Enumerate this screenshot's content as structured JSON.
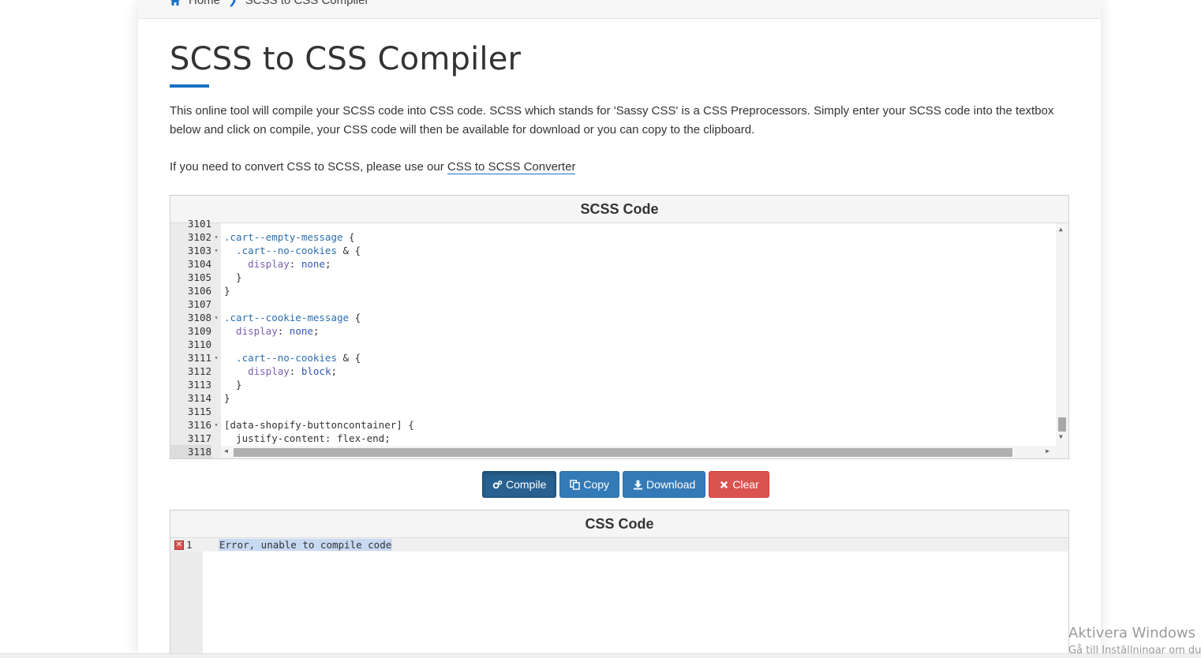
{
  "breadcrumb": {
    "home": "Home",
    "current": "SCSS to CSS Compiler"
  },
  "page": {
    "title": "SCSS to CSS Compiler",
    "intro": "This online tool will compile your SCSS code into CSS code. SCSS which stands for 'Sassy CSS' is a CSS Preprocessors. Simply enter your SCSS code into the textbox below and click on compile, your CSS code will then be available for download or you can copy to the clipboard.",
    "convert_prefix": "If you need to convert CSS to SCSS, please use our ",
    "convert_link": "CSS to SCSS Converter"
  },
  "scss_panel": {
    "title": "SCSS Code",
    "lines": [
      {
        "n": "3101",
        "fold": "",
        "sel": "",
        "rest": ""
      },
      {
        "n": "3102",
        "fold": "▾",
        "sel": ".cart--empty-message",
        "rest": " {"
      },
      {
        "n": "3103",
        "fold": "▾",
        "sel": "  .cart--no-cookies",
        "rest": " & {"
      },
      {
        "n": "3104",
        "fold": "",
        "prop": "    display",
        "val": "none",
        "rest": ";"
      },
      {
        "n": "3105",
        "fold": "",
        "sel": "",
        "rest": "  }"
      },
      {
        "n": "3106",
        "fold": "",
        "sel": "",
        "rest": "}"
      },
      {
        "n": "3107",
        "fold": "",
        "sel": "",
        "rest": ""
      },
      {
        "n": "3108",
        "fold": "▾",
        "sel": ".cart--cookie-message",
        "rest": " {"
      },
      {
        "n": "3109",
        "fold": "",
        "prop": "  display",
        "val": "none",
        "rest": ";"
      },
      {
        "n": "3110",
        "fold": "",
        "sel": "",
        "rest": ""
      },
      {
        "n": "3111",
        "fold": "▾",
        "sel": "  .cart--no-cookies",
        "rest": " & {"
      },
      {
        "n": "3112",
        "fold": "",
        "prop": "    display",
        "val": "block",
        "rest": ";"
      },
      {
        "n": "3113",
        "fold": "",
        "sel": "",
        "rest": "  }"
      },
      {
        "n": "3114",
        "fold": "",
        "sel": "",
        "rest": "}"
      },
      {
        "n": "3115",
        "fold": "",
        "sel": "",
        "rest": ""
      },
      {
        "n": "3116",
        "fold": "▾",
        "sel": "",
        "rest": "[data-shopify-buttoncontainer] {"
      },
      {
        "n": "3117",
        "fold": "",
        "sel": "",
        "rest": "  justify-content: flex-end;"
      },
      {
        "n": "3118",
        "fold": "",
        "sel": "",
        "rest": ""
      }
    ]
  },
  "buttons": {
    "compile": "Compile",
    "copy": "Copy",
    "download": "Download",
    "clear": "Clear"
  },
  "css_panel": {
    "title": "CSS Code",
    "line_number": "1",
    "error_text": "Error, unable to compile code"
  },
  "watermark": {
    "line1": "Aktivera Windows",
    "line2": "Gå till Inställningar om du"
  },
  "colors": {
    "primary": "#337ab7",
    "primary_active": "#286090",
    "danger": "#d9534f",
    "accent": "#1a6fc4"
  }
}
